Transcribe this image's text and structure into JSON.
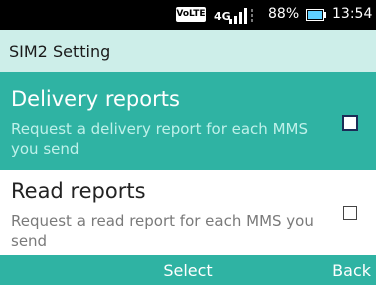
{
  "status": {
    "volte": "VoLTE",
    "network": "4G",
    "battery_pct": "88%",
    "time": "13:54"
  },
  "header": {
    "title": "SIM2 Setting"
  },
  "items": [
    {
      "title": "Delivery reports",
      "subtitle": "Request a delivery report for each MMS you send",
      "checked": false,
      "selected": true
    },
    {
      "title": "Read reports",
      "subtitle": "Request a read report for each MMS you send",
      "checked": false,
      "selected": false
    }
  ],
  "softkeys": {
    "center": "Select",
    "right": "Back"
  },
  "colors": {
    "accent": "#2fb3a3",
    "header_bg": "#cdeee9"
  }
}
